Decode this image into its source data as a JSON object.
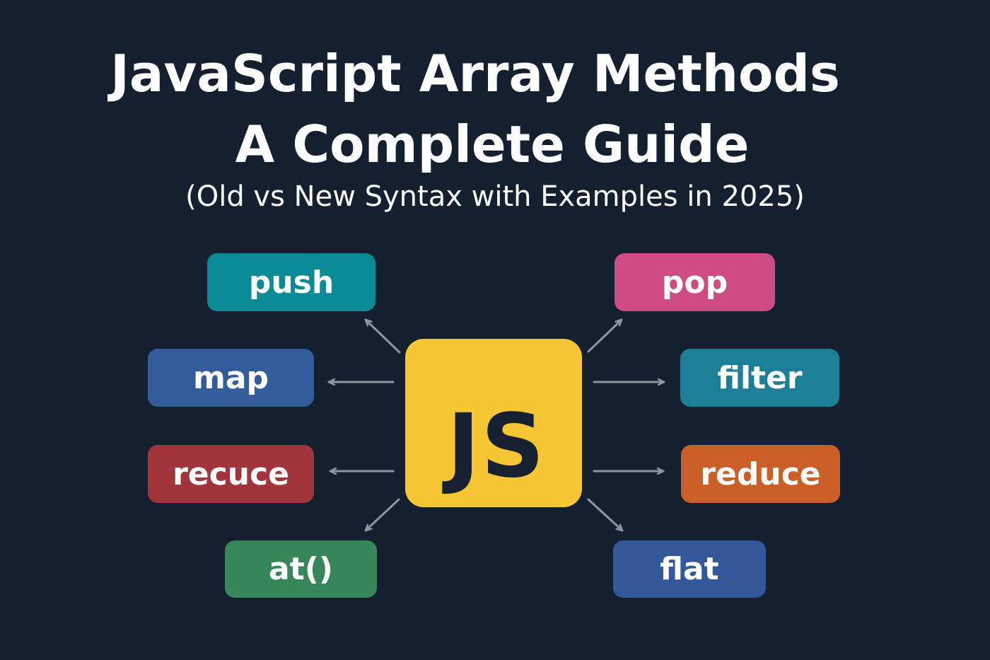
{
  "header": {
    "title_line1": "JavaScript Array Methods",
    "title_line2": "A Complete Guide",
    "subtitle": "(Old vs New Syntax with Examples in 2025)"
  },
  "center": {
    "logo_text": "JS",
    "logo_color": "#f7c634"
  },
  "methods": [
    {
      "label": "push",
      "color": "#0c8a95"
    },
    {
      "label": "map",
      "color": "#335d9a"
    },
    {
      "label": "recuce",
      "color": "#a1353b"
    },
    {
      "label": "at()",
      "color": "#37875a"
    },
    {
      "label": "pop",
      "color": "#cf4c83"
    },
    {
      "label": "filter",
      "color": "#1c7f98"
    },
    {
      "label": "reduce",
      "color": "#cb5f27"
    },
    {
      "label": "flat",
      "color": "#33599a"
    }
  ],
  "colors": {
    "background": "#14202f",
    "arrow": "#8e96a2",
    "text": "#ffffff"
  }
}
